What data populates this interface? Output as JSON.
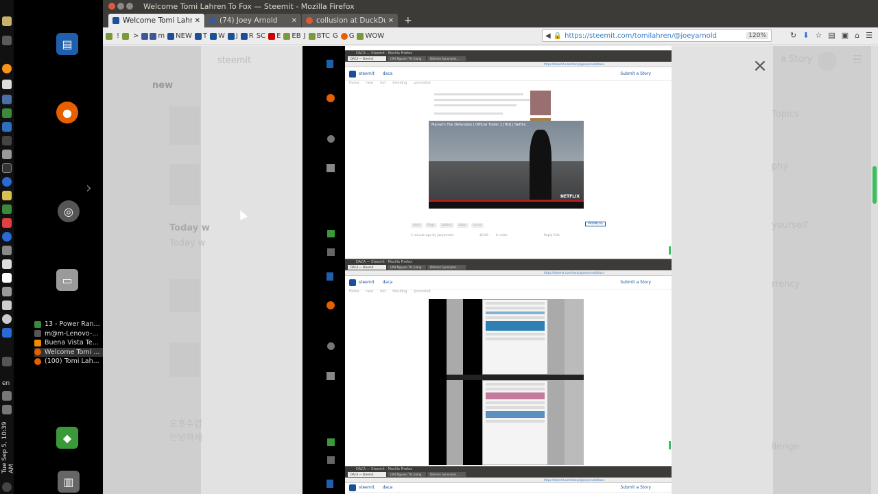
{
  "window": {
    "title": "Welcome Tomi Lahren To Fox — Steemit - Mozilla Firefox"
  },
  "tabs": [
    {
      "label": "Welcome Tomi Lahren",
      "active": true
    },
    {
      "label": "(74) Joey Arnold",
      "active": false
    },
    {
      "label": "collusion at DuckDuck",
      "active": false
    }
  ],
  "new_tab": "+",
  "bookmarks": [
    "!",
    ">",
    "m",
    "NEW",
    "T",
    "W",
    "J",
    "R",
    "SC",
    "E",
    "EB",
    "J",
    "BTC",
    "G",
    "G",
    "WOW"
  ],
  "url": "https://steemit.com/tomilahren/@joeyarnold",
  "zoom": "120%",
  "system_panel": {
    "clock": "Tue Sep 5, 10:39 AM",
    "keyboard": "en",
    "tasks": [
      {
        "label": "13 - Power Ran..."
      },
      {
        "label": "m@m-Lenovo-..."
      },
      {
        "label": "Buena Vista Te..."
      },
      {
        "label": "Welcome Tomi ..."
      },
      {
        "label": "(100) Tomi Lah..."
      }
    ]
  },
  "page_ghost": {
    "brand": "steemit",
    "nav_new": "new",
    "right_story": "a Story",
    "topics": "Topics",
    "today": "Today w",
    "today2": "Today w",
    "korean1": "오후수업",
    "korean2": "안녕하세",
    "right_1": "phy",
    "right_2": "yourself",
    "right_3": "rrency",
    "right_4": "llenge"
  },
  "modal": {
    "close": "×"
  },
  "embedded": {
    "frame_title": "DACA — Steemit - Mozilla Firefox",
    "tab1": "DACA — Steemit",
    "tab2": "(49) Nguyen Thi Giang",
    "tab3": "Distress Synonyms...",
    "url": "https://steemit.com/daca/@joeyarnold/daca",
    "brand": "steemit",
    "section": "daca",
    "submit": "Submit a Story",
    "subnav": [
      "Home",
      "new",
      "hot",
      "trending",
      "promoted"
    ],
    "video_title": "Marvel's The Defenders | Official Trailer 2 [HD] | Netflix",
    "video_brand": "NETFLIX",
    "tags": [
      "daca",
      "flags",
      "babies",
      "baby",
      "cyrus"
    ],
    "promote": "PROMOTE",
    "meta": "1 minute ago by joeyarnold",
    "payout": "$0.00",
    "votes": "0 votes",
    "reply": "Reply  Edit"
  }
}
